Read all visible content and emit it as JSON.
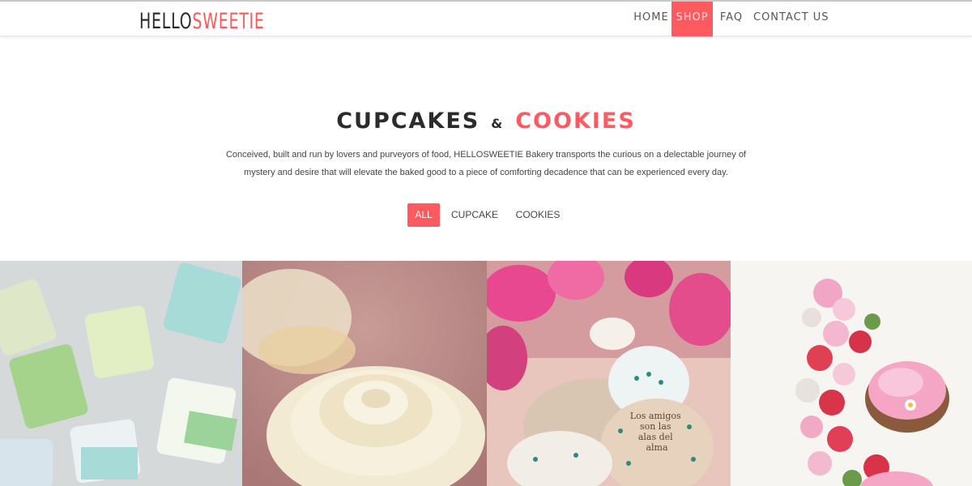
{
  "brand": {
    "logo_part1": "HELLO",
    "logo_part2": "SWEETIE"
  },
  "nav": {
    "items": [
      {
        "label": "HOME",
        "active": false
      },
      {
        "label": "SHOP",
        "active": true
      },
      {
        "label": "FAQ",
        "active": false
      },
      {
        "label": "CONTACT US",
        "active": false
      }
    ]
  },
  "hero": {
    "title_part1": "CUPCAKES",
    "title_sep": "&",
    "title_part2": "COOKIES",
    "description": "Conceived, built and run by lovers and purveyors of food, HELLOSWEETIE Bakery transports the curious on a delectable journey of mystery and desire that will elevate the baked good to a piece of comforting decadence that can be experienced every day."
  },
  "filters": {
    "items": [
      {
        "label": "ALL",
        "active": true
      },
      {
        "label": "CUPCAKE",
        "active": false
      },
      {
        "label": "COOKIES",
        "active": false
      }
    ]
  },
  "gallery": {
    "tiles": [
      {
        "alt": "onesie cookies",
        "text": ""
      },
      {
        "alt": "rose frosting cupcake",
        "text": ""
      },
      {
        "alt": "flower cookies",
        "text": "Los amigos son las alas del alma"
      },
      {
        "alt": "strawberries cupcakes",
        "text": ""
      }
    ]
  },
  "colors": {
    "accent": "#ff5a5f",
    "dark_text": "#2b2b2b",
    "body_text": "#444444"
  }
}
